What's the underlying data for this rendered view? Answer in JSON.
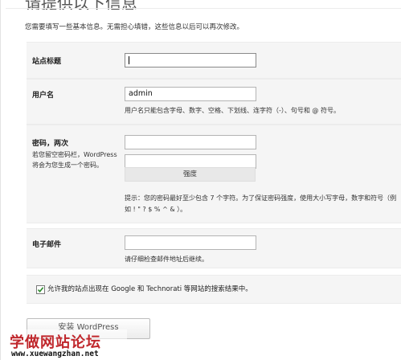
{
  "heading": "请提供以下信息",
  "intro": "您需要填写一些基本信息。无需担心填错，这些信息以后可以再次修改。",
  "site_title": {
    "label": "站点标题",
    "value": ""
  },
  "username": {
    "label": "用户名",
    "value": "admin",
    "hint": "用户名只能包含字母、数字、空格、下划线、连字符（-）、句号和 @ 符号。"
  },
  "password": {
    "label": "密码，两次",
    "sublabel": "若您留空密码栏，WordPress 将会为您生成一个密码。",
    "value1": "",
    "value2": "",
    "strength": "强度",
    "hint_line1": "提示：您的密码最好至少包含 7 个字符。为了保证密码强度，使用大小写字母，数字和符号（例",
    "hint_line2": "如 ! \" ? $ % ^ & ）。"
  },
  "email": {
    "label": "电子邮件",
    "value": "",
    "hint": "请仔细检查邮件地址后继续。"
  },
  "privacy": {
    "checked": true,
    "label": "允许我的站点出现在 Google 和 Technorati 等网站的搜索结果中。"
  },
  "install_button": "安装 WordPress",
  "watermark": {
    "title": "学做网站论坛",
    "url": "www.xuewangzhan.net"
  },
  "colors": {
    "row_background": "#f5f5f5",
    "border": "#ececec",
    "watermark_red": "#c0282d",
    "checkbox_green": "#2a8a2a"
  }
}
